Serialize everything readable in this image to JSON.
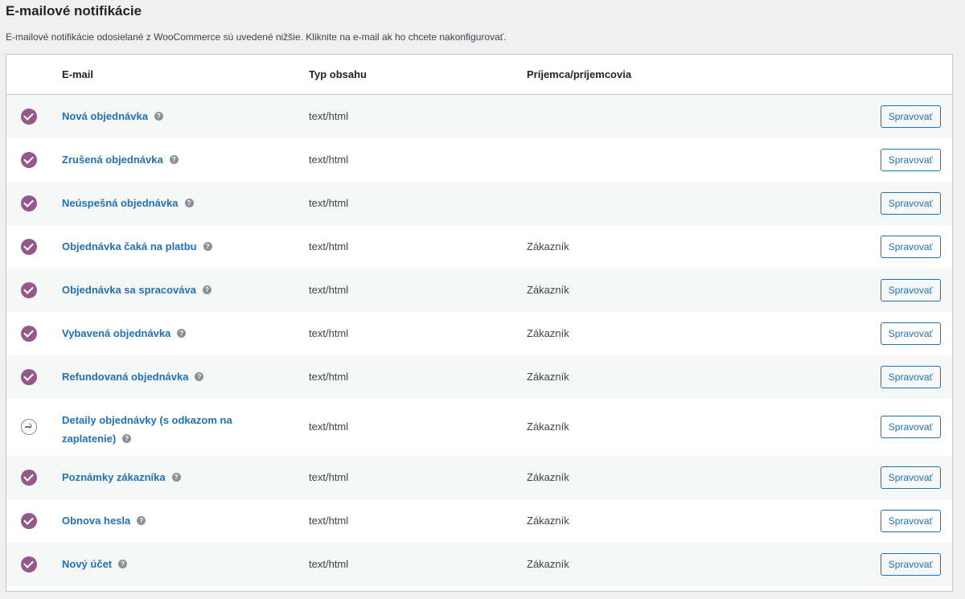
{
  "page": {
    "title": "E-mailové notifikácie",
    "description": "E-mailové notifikácie odosielané z WooCommerce sú uvedené nižšie. Kliknite na e-mail ak ho chcete nakonfigurovať."
  },
  "table": {
    "headers": {
      "email": "E-mail",
      "type": "Typ obsahu",
      "recipient": "Príjemca/príjemcovia"
    },
    "rows": [
      {
        "status": "enabled",
        "name": "Nová objednávka",
        "type": "text/html",
        "recipient": "",
        "action": "Spravovať"
      },
      {
        "status": "enabled",
        "name": "Zrušená objednávka",
        "type": "text/html",
        "recipient": "",
        "action": "Spravovať"
      },
      {
        "status": "enabled",
        "name": "Neúspešná objednávka",
        "type": "text/html",
        "recipient": "",
        "action": "Spravovať"
      },
      {
        "status": "enabled",
        "name": "Objednávka čaká na platbu",
        "type": "text/html",
        "recipient": "Zákazník",
        "action": "Spravovať"
      },
      {
        "status": "enabled",
        "name": "Objednávka sa spracováva",
        "type": "text/html",
        "recipient": "Zákazník",
        "action": "Spravovať"
      },
      {
        "status": "enabled",
        "name": "Vybavená objednávka",
        "type": "text/html",
        "recipient": "Zákazník",
        "action": "Spravovať"
      },
      {
        "status": "enabled",
        "name": "Refundovaná objednávka",
        "type": "text/html",
        "recipient": "Zákazník",
        "action": "Spravovať"
      },
      {
        "status": "manual",
        "name": "Detaily objednávky (s odkazom na zaplatenie)",
        "type": "text/html",
        "recipient": "Zákazník",
        "action": "Spravovať"
      },
      {
        "status": "enabled",
        "name": "Poznámky zákazníka",
        "type": "text/html",
        "recipient": "Zákazník",
        "action": "Spravovať"
      },
      {
        "status": "enabled",
        "name": "Obnova hesla",
        "type": "text/html",
        "recipient": "Zákazník",
        "action": "Spravovať"
      },
      {
        "status": "enabled",
        "name": "Nový účet",
        "type": "text/html",
        "recipient": "Zákazník",
        "action": "Spravovať"
      }
    ]
  },
  "icons": {
    "enabled": "check-circle-icon",
    "manual": "arrow-circle-icon",
    "help": "help-question-icon"
  },
  "colors": {
    "enabled_status": "#96588a",
    "link": "#2271b1",
    "background": "#f0f0f1"
  }
}
